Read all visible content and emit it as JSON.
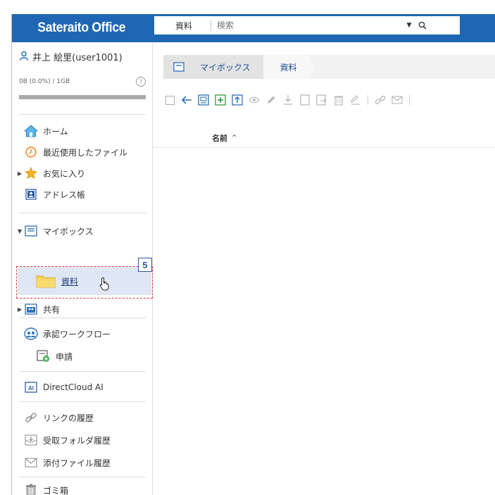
{
  "header": {
    "logo": "Sateraito Office",
    "search_scope": "資料",
    "search_placeholder": "検索"
  },
  "user": {
    "name": "井上 絵里(user1001)",
    "quota_text": "0B (0.0%) / 1GB",
    "quota_used_fraction": 0.0
  },
  "sidebar": {
    "items": [
      {
        "label": "ホーム"
      },
      {
        "label": "最近使用したファイル"
      },
      {
        "label": "お気に入り"
      },
      {
        "label": "アドレス帳"
      },
      {
        "label": "マイボックス"
      },
      {
        "label": "資料"
      },
      {
        "label": "共有"
      },
      {
        "label": "承認ワークフロー"
      },
      {
        "label": "申請"
      },
      {
        "label": "DirectCloud AI"
      },
      {
        "label": "リンクの履歴"
      },
      {
        "label": "受取フォルダ履歴"
      },
      {
        "label": "添付ファイル履歴"
      },
      {
        "label": "ゴミ箱"
      }
    ]
  },
  "step_badge": "5",
  "breadcrumb": [
    "マイボックス",
    "資料"
  ],
  "list": {
    "column_name": "名前",
    "sort_indicator": "^"
  },
  "colors": {
    "brand": "#1f67b3",
    "selected": "#dfe6f4",
    "highlight": "#e23a3a",
    "badge": "#2e58a6"
  }
}
